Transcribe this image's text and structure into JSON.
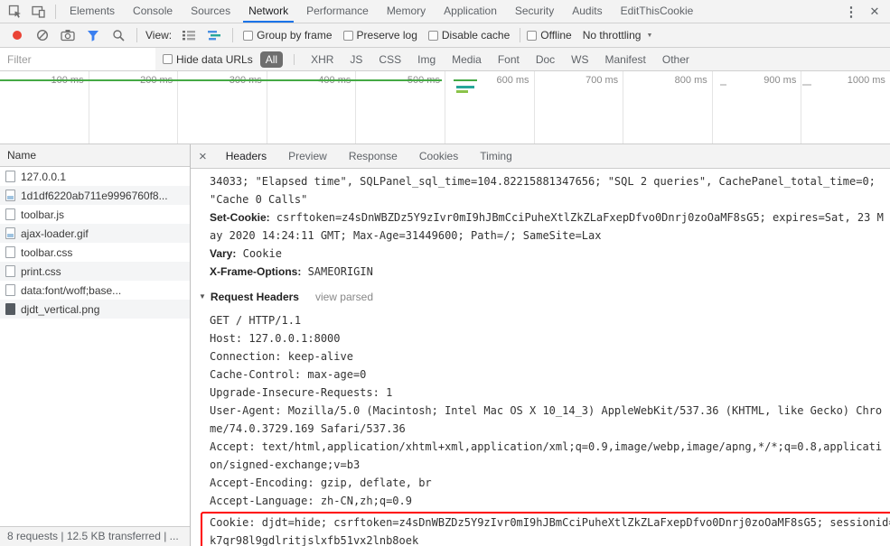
{
  "window": {
    "tabs": [
      "Elements",
      "Console",
      "Sources",
      "Network",
      "Performance",
      "Memory",
      "Application",
      "Security",
      "Audits",
      "EditThisCookie"
    ],
    "active_tab": "Network"
  },
  "icons": {
    "more": "⋮",
    "close": "✕",
    "details_close": "×",
    "caret": "▼",
    "disclosure": "▼"
  },
  "net_toolbar": {
    "view_label": "View:",
    "left_checkboxes": [
      "Group by frame",
      "Preserve log",
      "Disable cache"
    ],
    "offline_label": "Offline",
    "throttling_value": "No throttling"
  },
  "filter_bar": {
    "placeholder": "Filter",
    "hide_data_urls_label": "Hide data URLs",
    "type_pills": [
      "All",
      "XHR",
      "JS",
      "CSS",
      "Img",
      "Media",
      "Font",
      "Doc",
      "WS",
      "Manifest",
      "Other"
    ],
    "active_pill": "All"
  },
  "timeline": {
    "ticks": [
      "100 ms",
      "200 ms",
      "300 ms",
      "400 ms",
      "500 ms",
      "600 ms",
      "700 ms",
      "800 ms",
      "900 ms",
      "1000 ms"
    ]
  },
  "request_list": {
    "header": "Name",
    "items": [
      {
        "name": "127.0.0.1",
        "icon": "document-icon",
        "type": "doc"
      },
      {
        "name": "1d1df6220ab711e9996760f8...",
        "icon": "image-icon",
        "type": "img"
      },
      {
        "name": "toolbar.js",
        "icon": "script-icon",
        "type": "doc"
      },
      {
        "name": "ajax-loader.gif",
        "icon": "image-icon",
        "type": "img"
      },
      {
        "name": "toolbar.css",
        "icon": "stylesheet-icon",
        "type": "doc"
      },
      {
        "name": "print.css",
        "icon": "stylesheet-icon",
        "type": "doc"
      },
      {
        "name": "data:font/woff;base...",
        "icon": "font-icon",
        "type": "doc"
      },
      {
        "name": "djdt_vertical.png",
        "icon": "image-icon",
        "type": "img-dark"
      }
    ]
  },
  "details": {
    "tabs": [
      "Headers",
      "Preview",
      "Response",
      "Cookies",
      "Timing"
    ],
    "active_tab": "Headers",
    "response_tail": [
      {
        "name": "",
        "value": "34033; \"Elapsed time\", SQLPanel_sql_time=104.82215881347656; \"SQL 2 queries\", CachePanel_total_time=0; \"Cache 0 Calls\""
      },
      {
        "name": "Set-Cookie:",
        "value": "csrftoken=z4sDnWBZDz5Y9zIvr0mI9hJBmCciPuheXtlZkZLaFxepDfvo0Dnrj0zoOaMF8sG5; expires=Sat, 23 May 2020 14:24:11 GMT; Max-Age=31449600; Path=/; SameSite=Lax"
      },
      {
        "name": "Vary:",
        "value": "Cookie"
      },
      {
        "name": "X-Frame-Options:",
        "value": "SAMEORIGIN"
      }
    ],
    "request_headers_section": {
      "title": "Request Headers",
      "toggle": "view parsed"
    },
    "request_raw_lines": [
      "GET / HTTP/1.1",
      "Host: 127.0.0.1:8000",
      "Connection: keep-alive",
      "Cache-Control: max-age=0",
      "Upgrade-Insecure-Requests: 1",
      "User-Agent: Mozilla/5.0 (Macintosh; Intel Mac OS X 10_14_3) AppleWebKit/537.36 (KHTML, like Gecko) Chrome/74.0.3729.169 Safari/537.36",
      "Accept: text/html,application/xhtml+xml,application/xml;q=0.9,image/webp,image/apng,*/*;q=0.8,application/signed-exchange;v=b3",
      "Accept-Encoding: gzip, deflate, br",
      "Accept-Language: zh-CN,zh;q=0.9"
    ],
    "highlighted_line": "Cookie: djdt=hide; csrftoken=z4sDnWBZDz5Y9zIvr0mI9hJBmCciPuheXtlZkZLaFxepDfvo0Dnrj0zoOaMF8sG5; sessionid=k7qr98l9gdlritjslxfb51vx2lnb8oek"
  },
  "status_bar": {
    "text": "8 requests | 12.5 KB transferred | ..."
  },
  "colors": {
    "accent_blue": "#1a73e8",
    "record_red": "#ea4335",
    "highlight_red": "#ff0000",
    "timeline_green": "#45a945",
    "bar_teal": "#26a69a",
    "bar_green": "#8bc34a"
  }
}
